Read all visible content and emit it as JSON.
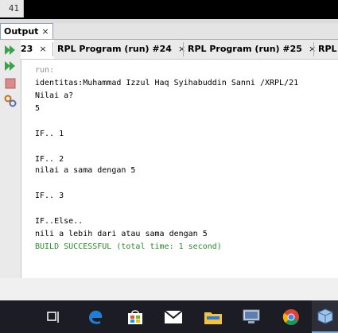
{
  "editor": {
    "line_number": "41"
  },
  "output_panel": {
    "tab_label": "Output",
    "close_glyph": "×"
  },
  "run_tabs": [
    {
      "label": "23",
      "active": true
    },
    {
      "label": "RPL Program (run) #24",
      "active": false
    },
    {
      "label": "RPL Program (run) #25",
      "active": false
    },
    {
      "label": "RPL",
      "active": false
    }
  ],
  "toolbar": {
    "icons": [
      "rerun-icon",
      "rerun-with-params-icon",
      "stop-icon",
      "settings-icon"
    ]
  },
  "console": {
    "lines": [
      {
        "text": "run:",
        "style": "gray"
      },
      {
        "text": "identitas:Muhammad Izzul Haq Syihabuddin Sanni /XRPL/21",
        "style": "normal"
      },
      {
        "text": "Nilai a?",
        "style": "normal"
      },
      {
        "text": "5",
        "style": "normal"
      },
      {
        "text": "",
        "style": "normal"
      },
      {
        "text": "IF.. 1",
        "style": "normal"
      },
      {
        "text": "",
        "style": "normal"
      },
      {
        "text": "IF.. 2",
        "style": "normal"
      },
      {
        "text": "nilai a sama dengan 5",
        "style": "normal"
      },
      {
        "text": "",
        "style": "normal"
      },
      {
        "text": "IF.. 3",
        "style": "normal"
      },
      {
        "text": "",
        "style": "normal"
      },
      {
        "text": "IF..Else..",
        "style": "normal"
      },
      {
        "text": "nili a lebih dari atau sama dengan 5",
        "style": "normal"
      },
      {
        "text": "BUILD SUCCESSFUL (total time: 1 second)",
        "style": "green"
      }
    ]
  },
  "taskbar": {
    "items": [
      "task-view-icon",
      "edge-icon",
      "store-icon",
      "mail-icon",
      "file-explorer-icon",
      "remote-desktop-icon",
      "chrome-icon",
      "virtualbox-icon"
    ],
    "colors": {
      "edge": "#1e7fd6",
      "accent": "#7fa7d9"
    }
  }
}
